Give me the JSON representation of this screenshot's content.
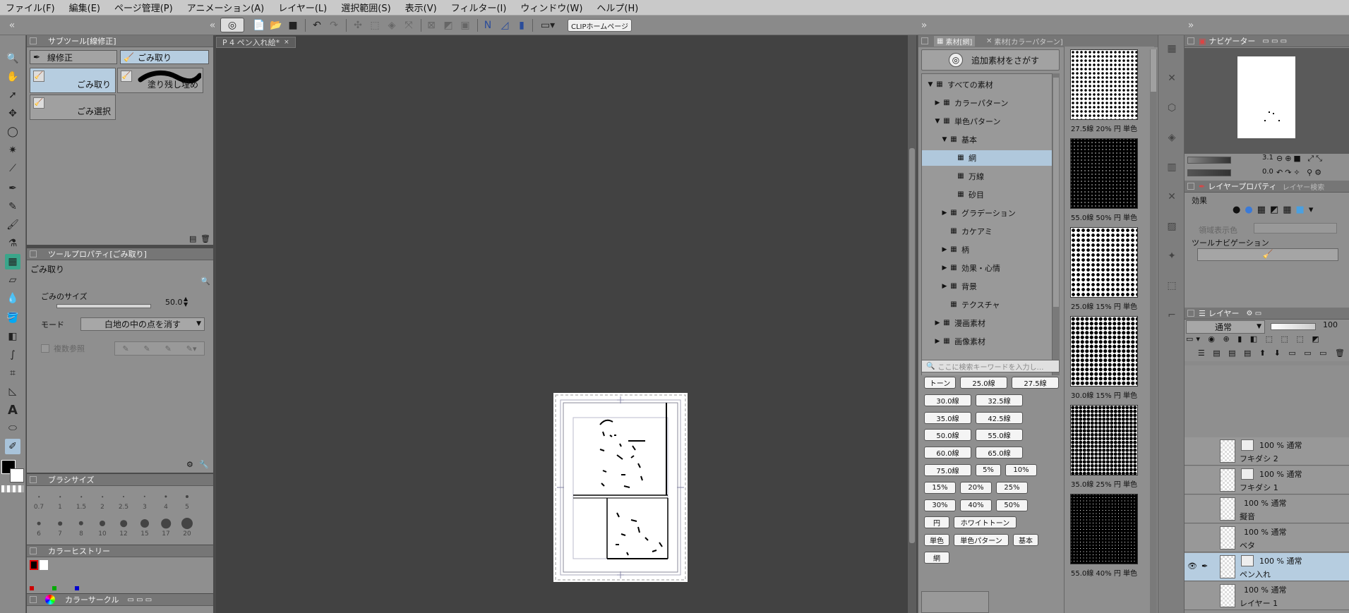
{
  "menu": [
    "ファイル(F)",
    "編集(E)",
    "ページ管理(P)",
    "アニメーション(A)",
    "レイヤー(L)",
    "選択範囲(S)",
    "表示(V)",
    "フィルター(I)",
    "ウィンドウ(W)",
    "ヘルプ(H)"
  ],
  "command_bar": {
    "clip_home": "CLIPホームページ"
  },
  "subtool_panel": {
    "title": "サブツール[線修正]",
    "tabs": [
      "線修正",
      "ごみ取り"
    ],
    "items": [
      "ごみ取り",
      "塗り残し埋め",
      "ごみ選択"
    ]
  },
  "tool_property": {
    "title": "ツールプロパティ[ごみ取り]",
    "tool_name": "ごみ取り",
    "size_label": "ごみのサイズ",
    "size_value": "50.0",
    "mode_label": "モード",
    "mode_value": "白地の中の点を消す",
    "ref_label": "複数参照"
  },
  "brush_size": {
    "title": "ブラシサイズ",
    "row1": [
      "0.7",
      "1",
      "1.5",
      "2",
      "2.5",
      "3",
      "4",
      "5"
    ],
    "row2": [
      "6",
      "7",
      "8",
      "10",
      "12",
      "15",
      "17",
      "20"
    ]
  },
  "color_history": {
    "title": "カラーヒストリー"
  },
  "color_circle": {
    "title": "カラーサークル"
  },
  "document": {
    "tab": "P 4 ペン入れ絵*"
  },
  "material": {
    "tab1": "素材[網]",
    "tab2": "素材[カラーパターン]",
    "find_button": "追加素材をさがす",
    "tree": [
      {
        "label": "すべての素材",
        "indent": 0,
        "arrow": "▼"
      },
      {
        "label": "カラーパターン",
        "indent": 1,
        "arrow": "▶"
      },
      {
        "label": "単色パターン",
        "indent": 1,
        "arrow": "▼"
      },
      {
        "label": "基本",
        "indent": 2,
        "arrow": "▼"
      },
      {
        "label": "網",
        "indent": 3,
        "arrow": ""
      },
      {
        "label": "万線",
        "indent": 3,
        "arrow": ""
      },
      {
        "label": "砂目",
        "indent": 3,
        "arrow": ""
      },
      {
        "label": "グラデーション",
        "indent": 2,
        "arrow": "▶"
      },
      {
        "label": "カケアミ",
        "indent": 2,
        "arrow": ""
      },
      {
        "label": "柄",
        "indent": 2,
        "arrow": "▶"
      },
      {
        "label": "効果・心情",
        "indent": 2,
        "arrow": "▶"
      },
      {
        "label": "背景",
        "indent": 2,
        "arrow": "▶"
      },
      {
        "label": "テクスチャ",
        "indent": 2,
        "arrow": ""
      },
      {
        "label": "漫画素材",
        "indent": 1,
        "arrow": "▶"
      },
      {
        "label": "画像素材",
        "indent": 1,
        "arrow": "▶"
      }
    ],
    "search_placeholder": "ここに検索キーワードを入力し…",
    "tags": [
      [
        "トーン",
        "25.0線",
        "27.5線"
      ],
      [
        "30.0線",
        "32.5線"
      ],
      [
        "35.0線",
        "42.5線"
      ],
      [
        "50.0線",
        "55.0線"
      ],
      [
        "60.0線",
        "65.0線"
      ],
      [
        "75.0線",
        "5%",
        "10%"
      ],
      [
        "15%",
        "20%",
        "25%"
      ],
      [
        "30%",
        "40%",
        "50%"
      ],
      [
        "円",
        "ホワイトトーン"
      ],
      [
        "単色",
        "単色パターン",
        "基本"
      ],
      [
        "網"
      ]
    ],
    "swatches": [
      "27.5線 20% 円 単色",
      "55.0線 50% 円 単色",
      "25.0線 15% 円 単色",
      "30.0線 15% 円 単色",
      "35.0線 25% 円 単色",
      "55.0線 40% 円 単色"
    ]
  },
  "navigator": {
    "title": "ナビゲーター",
    "zoom": "3.1",
    "angle": "0.0"
  },
  "layer_property": {
    "title": "レイヤープロパティ",
    "tab2": "レイヤー検索",
    "effect_label": "効果",
    "range_label": "領域表示色",
    "tool_nav_label": "ツールナビゲーション"
  },
  "layer_panel": {
    "title": "レイヤー",
    "blend_mode": "通常",
    "opacity": "100",
    "layers": [
      {
        "blend": "100 % 通常",
        "name": "フキダシ 2",
        "selected": false
      },
      {
        "blend": "100 % 通常",
        "name": "フキダシ 1",
        "selected": false
      },
      {
        "blend": "100 % 通常",
        "name": "擬音",
        "selected": false
      },
      {
        "blend": "100 % 通常",
        "name": "ベタ",
        "selected": false
      },
      {
        "blend": "100 % 通常",
        "name": "ペン入れ",
        "selected": true
      },
      {
        "blend": "100 % 通常",
        "name": "レイヤー 1",
        "selected": false
      }
    ]
  },
  "colors": {
    "accent": "#b6cde0",
    "panel": "#8f8f8f",
    "canvas": "#424242",
    "menubar": "#c9c9c9"
  }
}
